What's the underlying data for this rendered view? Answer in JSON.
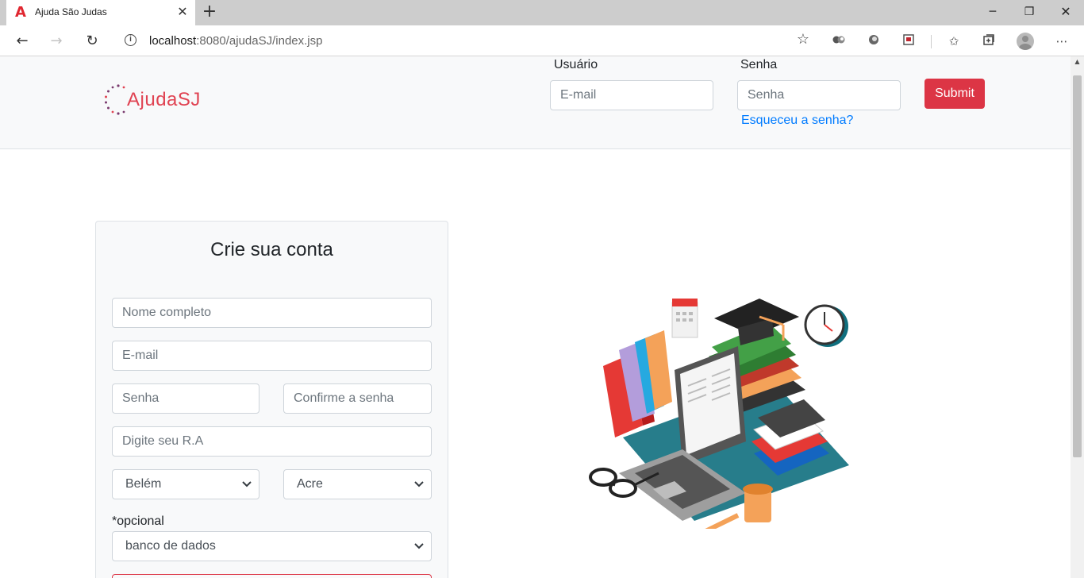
{
  "browser": {
    "tab_title": "Ajuda São Judas",
    "tab_favicon_letter": "A",
    "url_host": "localhost",
    "url_rest": ":8080/ajudaSJ/index.jsp"
  },
  "header": {
    "logo_text": "AjudaSJ",
    "user_label": "Usuário",
    "email_placeholder": "E-mail",
    "password_label": "Senha",
    "password_placeholder": "Senha",
    "forgot_link": "Esqueceu a senha?",
    "submit_label": "Submit"
  },
  "signup": {
    "title": "Crie sua conta",
    "name_placeholder": "Nome completo",
    "email_placeholder": "E-mail",
    "password_placeholder": "Senha",
    "confirm_placeholder": "Confirme a senha",
    "ra_placeholder": "Digite seu R.A",
    "city_selected": "Belém",
    "state_selected": "Acre",
    "optional_label": "*opcional",
    "interest_selected": "banco de dados"
  },
  "colors": {
    "brand": "#e04352",
    "danger": "#dc3545",
    "link": "#007bff"
  }
}
